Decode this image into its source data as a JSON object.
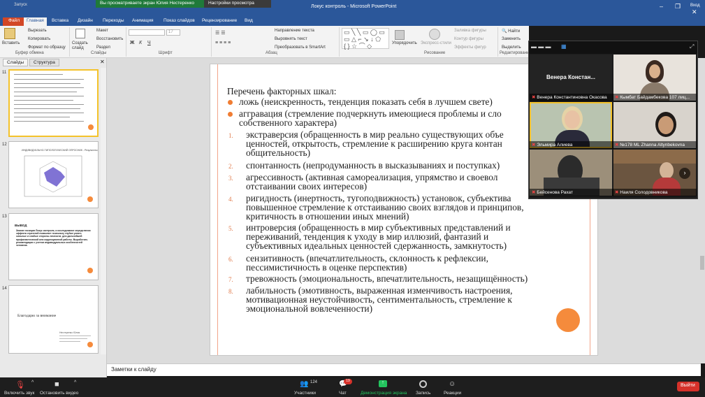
{
  "window": {
    "title": "Локус контроль - Microsoft PowerPoint",
    "share_banner": "Вы просматриваете экран Юлия Нестеренко",
    "view_options": "Настройки просмотра",
    "quick_access": "Запуск",
    "sign_in": "Вход"
  },
  "ribbon": {
    "tabs": [
      "Файл",
      "Главная",
      "Вставка",
      "Дизайн",
      "Переходы",
      "Анимация",
      "Показ слайдов",
      "Рецензирование",
      "Вид"
    ],
    "clipboard": {
      "paste": "Вставить",
      "cut": "Вырезать",
      "copy": "Копировать",
      "format": "Формат по образцу",
      "group": "Буфер обмена"
    },
    "slides": {
      "create": "Создать слайд",
      "layout": "Макет",
      "reset": "Восстановить",
      "section": "Раздел",
      "group": "Слайды"
    },
    "font": {
      "size": "17",
      "group": "Шрифт"
    },
    "paragraph": {
      "direction": "Направление текста",
      "align": "Выровнять текст",
      "smartart": "Преобразовать в SmartArt",
      "group": "Абзац"
    },
    "drawing": {
      "arrange": "Упорядочить",
      "styles": "Экспресс-стили",
      "fill": "Заливка фигуры",
      "outline": "Контур фигуры",
      "effects": "Эффекты фигур",
      "group": "Рисование"
    },
    "editing": {
      "find": "Найти",
      "replace": "Заменить",
      "select": "Выделить",
      "group": "Редактирование"
    }
  },
  "left_panel": {
    "tabs": [
      "Слайды",
      "Структура"
    ],
    "thumbs": [
      {
        "num": "11"
      },
      {
        "num": "12",
        "title": "ИНДИВИДУАЛЬНО-ТИПОЛОГИЧЕСКИЙ ОПРОСНИК - Результаты"
      },
      {
        "num": "13",
        "title": "ВЫВОД",
        "body": "Знание позиции Локус контроля, и исследование определения эффекта стратегий позволяет психологу глубже узнать сильные и слабые стороны личности, для дальнейшей профилактической или коррекционной работы. Выработать рекомендации с учетом индивидуальных особенностей человека."
      },
      {
        "num": "14",
        "title": "Благодарю за внимание",
        "footer": "Нестеренко Юлия"
      }
    ]
  },
  "slide": {
    "heading": "Перечень факторных шкал:",
    "bullets": [
      "ложь (неискренность, тенденция показать себя в лучшем свете)",
      "аггравация (стремление подчеркнуть  имеющиеся проблемы и сло",
      "собственного характера)"
    ],
    "items": [
      {
        "num": "1.",
        "lines": [
          "экстраверсия (обращенность в мир реально существующих объе",
          "ценностей, открытость, стремление к расширению круга контан",
          "общительность)"
        ]
      },
      {
        "num": "2.",
        "lines": [
          "спонтанность (непродуманность в высказываниях и поступках)"
        ]
      },
      {
        "num": "3.",
        "lines": [
          "агрессивность (активная самореализация, упрямство и своевол",
          "отстаивании своих интересов)"
        ]
      },
      {
        "num": "4.",
        "lines": [
          "ригидность (инертность, тугоподвижность)  установок, субъектива",
          "повышенное стремление к отстаиванию своих взглядов и принципов,",
          "критичность в отношении иных мнений)"
        ]
      },
      {
        "num": "5.",
        "lines": [
          "интроверсия (обращенность в мир субъективных представлений и",
          "переживаний, тенденция к уходу в мир иллюзий, фантазий и",
          "субъективных идеальных ценностей сдержанность, замкнутость)"
        ]
      },
      {
        "num": "6.",
        "lines": [
          "сензитивность (впечатлительность, склонность к рефлексии,",
          "пессимистичность в оценке перспектив)"
        ]
      },
      {
        "num": "7.",
        "lines": [
          "тревожность (эмоциональность, впечатлительность, незащищённость)"
        ]
      },
      {
        "num": "8.",
        "lines": [
          "лабильность (эмотивность, выраженная изменчивость настроения,",
          "мотивационная неустойчивость, сентиментальность, стремление к",
          "эмоциональной вовлеченности)"
        ]
      }
    ]
  },
  "notes": "Заметки к слайду",
  "zoom": {
    "participants": [
      {
        "name": "Венера  Констан..."
      },
      {
        "name": ""
      },
      {
        "name": "Венера Константиновна Окасова"
      },
      {
        "name": "Кымбат Байдамбекова 107 лиц..."
      },
      {
        "name": "Эльмира Алиева"
      },
      {
        "name": "№178 ML Zhanna Altynbekovna"
      },
      {
        "name": "Бейсенова Рахат"
      },
      {
        "name": "Наиля Солодовникова"
      }
    ]
  },
  "toolbar": {
    "mute": "Включить звук",
    "video": "Остановить видео",
    "participants": "Участники",
    "participants_count": "124",
    "chat": "Чат",
    "chat_badge": "19",
    "share": "Демонстрация экрана",
    "record": "Запись",
    "reactions": "Реакции",
    "leave": "Выйти"
  }
}
